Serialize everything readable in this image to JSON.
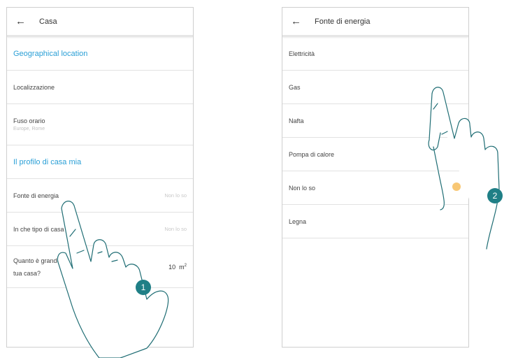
{
  "left_screen": {
    "title": "Casa",
    "rows": {
      "geo_section": "Geographical location",
      "localizzazione": "Localizzazione",
      "fuso_label": "Fuso orario",
      "fuso_value": "Europe, Rome",
      "profile_section": "Il profilo di casa mia",
      "fonte_label": "Fonte di energia",
      "fonte_value": "Non lo so",
      "tipo_label": "In che tipo di casa vivi?",
      "tipo_value": "Non lo so",
      "area_label_line1": "Quanto è grande",
      "area_label_line2": "tua casa?",
      "area_value": "10",
      "area_unit": "m",
      "area_unit_sup": "2"
    }
  },
  "right_screen": {
    "title": "Fonte di energia",
    "options": [
      "Elettricità",
      "Gas",
      "Nafta",
      "Pompa di calore",
      "Non lo so",
      "Legna"
    ]
  },
  "steps": [
    "1",
    "2"
  ],
  "icons": {
    "back": "arrow-left-icon",
    "hand": "pointing-hand-icon"
  },
  "colors": {
    "section_blue": "#2a9fd6",
    "step_badge": "#1f7f86",
    "touch_dot": "#f5b446"
  }
}
